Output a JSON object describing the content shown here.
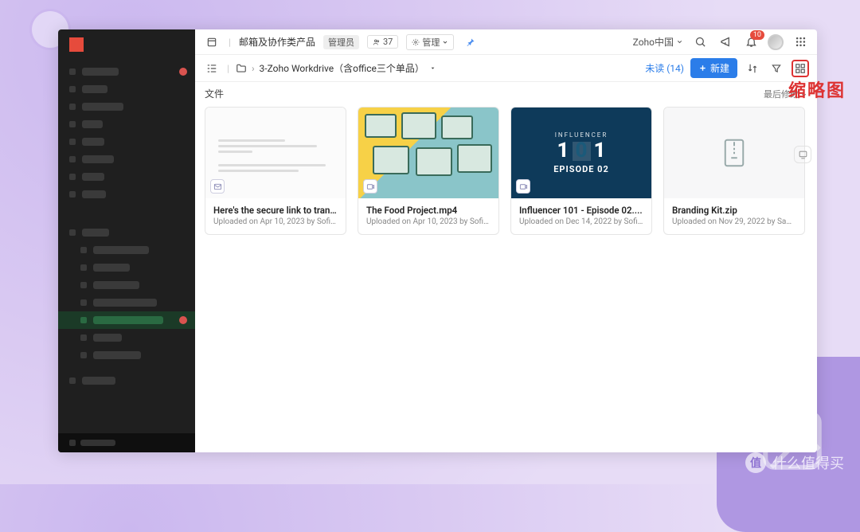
{
  "header": {
    "product_title": "邮箱及协作类产品",
    "role_badge": "管理员",
    "members_count": "37",
    "manage_label": "管理",
    "region": "Zoho中国",
    "bell_count": "10"
  },
  "toolbar": {
    "breadcrumb_folder": "3-Zoho Workdrive（含office三个单品）",
    "unread_label": "未读 (14)",
    "new_button": "新建"
  },
  "section": {
    "files_label": "文件",
    "sort_label": "最后修改"
  },
  "files": [
    {
      "title": "Here's the secure link to tran...",
      "subtitle": "Uploaded on Apr 10, 2023 by Sofia Del...",
      "kind": "doc"
    },
    {
      "title": "The Food Project.mp4",
      "subtitle": "Uploaded on Apr 10, 2023 by Sofia Del...",
      "kind": "food"
    },
    {
      "title": "Influencer 101 - Episode 02....",
      "subtitle": "Uploaded on Dec 14, 2022 by Sofia Del...",
      "kind": "influencer"
    },
    {
      "title": "Branding Kit.zip",
      "subtitle": "Uploaded on Nov 29, 2022 by Samuel ...",
      "kind": "zip"
    }
  ],
  "influencer": {
    "small": "INFLUENCER",
    "episode": "EPISODE 02"
  },
  "annotation": "缩略图",
  "watermark": "什么值得买",
  "watermark_badge": "值"
}
